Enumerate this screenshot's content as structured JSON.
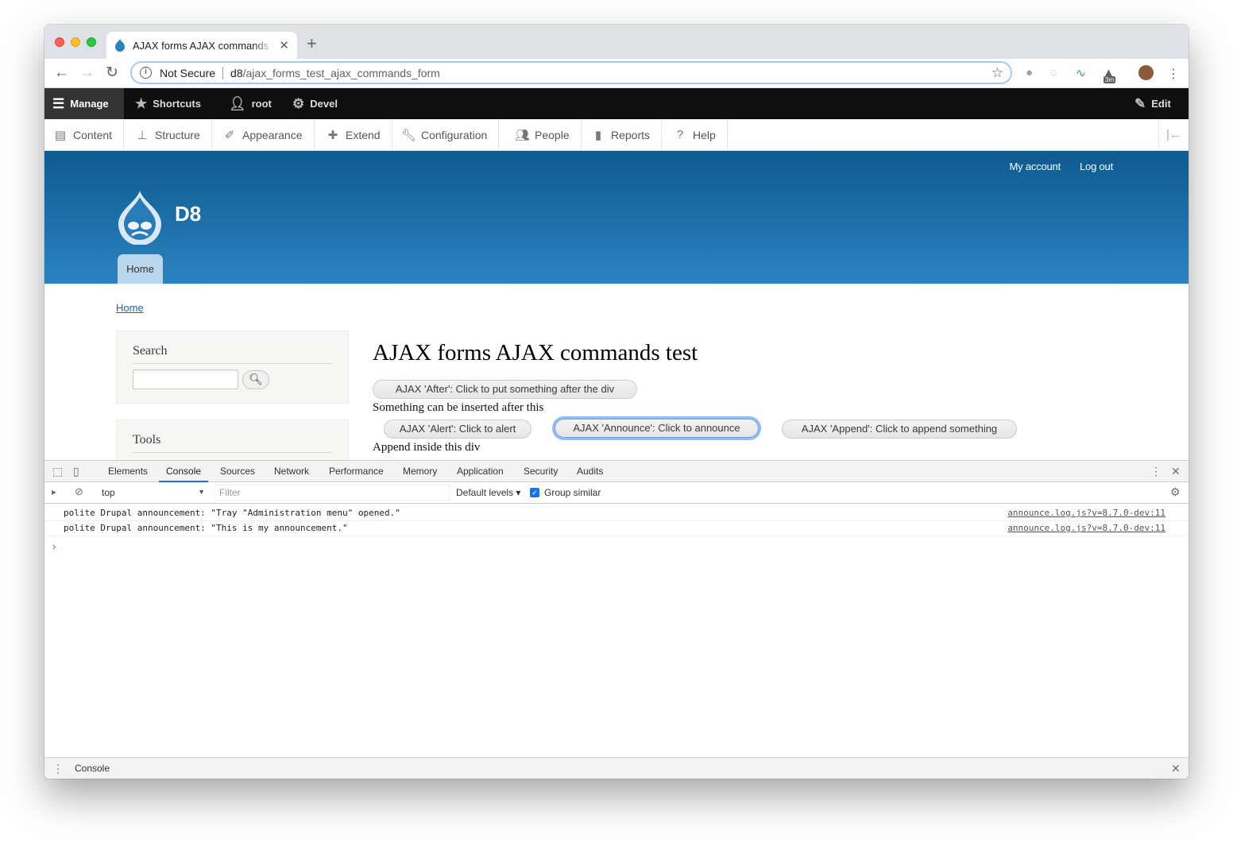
{
  "browser": {
    "tab_title": "AJAX forms AJAX commands test",
    "new_tab": "+",
    "security_label": "Not Secure",
    "url_host": "d8",
    "url_path": "/ajax_forms_test_ajax_commands_form",
    "ext_badge": "3m"
  },
  "admin_toolbar": {
    "manage": "Manage",
    "shortcuts": "Shortcuts",
    "user": "root",
    "devel": "Devel",
    "edit": "Edit"
  },
  "admin_tray": [
    {
      "label": "Content",
      "icon": "document-icon"
    },
    {
      "label": "Structure",
      "icon": "structure-icon"
    },
    {
      "label": "Appearance",
      "icon": "brush-icon"
    },
    {
      "label": "Extend",
      "icon": "puzzle-icon"
    },
    {
      "label": "Configuration",
      "icon": "wrench-icon"
    },
    {
      "label": "People",
      "icon": "people-icon"
    },
    {
      "label": "Reports",
      "icon": "bar-chart-icon"
    },
    {
      "label": "Help",
      "icon": "help-icon"
    }
  ],
  "site": {
    "my_account": "My account",
    "log_out": "Log out",
    "name": "D8",
    "home_tab": "Home",
    "brand_color": "#2a83c1"
  },
  "content": {
    "breadcrumb": "Home",
    "search_title": "Search",
    "tools_title": "Tools",
    "page_title": "AJAX forms AJAX commands test",
    "btn_after": "AJAX 'After': Click to put something after the div",
    "text_after": "Something can be inserted after this",
    "btn_alert": "AJAX 'Alert': Click to alert",
    "btn_announce": "AJAX 'Announce': Click to announce",
    "btn_append": "AJAX 'Append': Click to append something",
    "text_append": "Append inside this div"
  },
  "devtools": {
    "tabs": [
      "Elements",
      "Console",
      "Sources",
      "Network",
      "Performance",
      "Memory",
      "Application",
      "Security",
      "Audits"
    ],
    "active_tab": "Console",
    "context": "top",
    "filter_placeholder": "Filter",
    "levels": "Default levels",
    "group_similar": "Group similar",
    "console_lines": [
      {
        "message": "polite Drupal announcement: \"Tray \"Administration menu\" opened.\"",
        "source": "announce.log.js?v=8.7.0-dev:11"
      },
      {
        "message": "polite Drupal announcement: \"This is my announcement.\"",
        "source": "announce.log.js?v=8.7.0-dev:11"
      }
    ],
    "drawer_tab": "Console"
  }
}
